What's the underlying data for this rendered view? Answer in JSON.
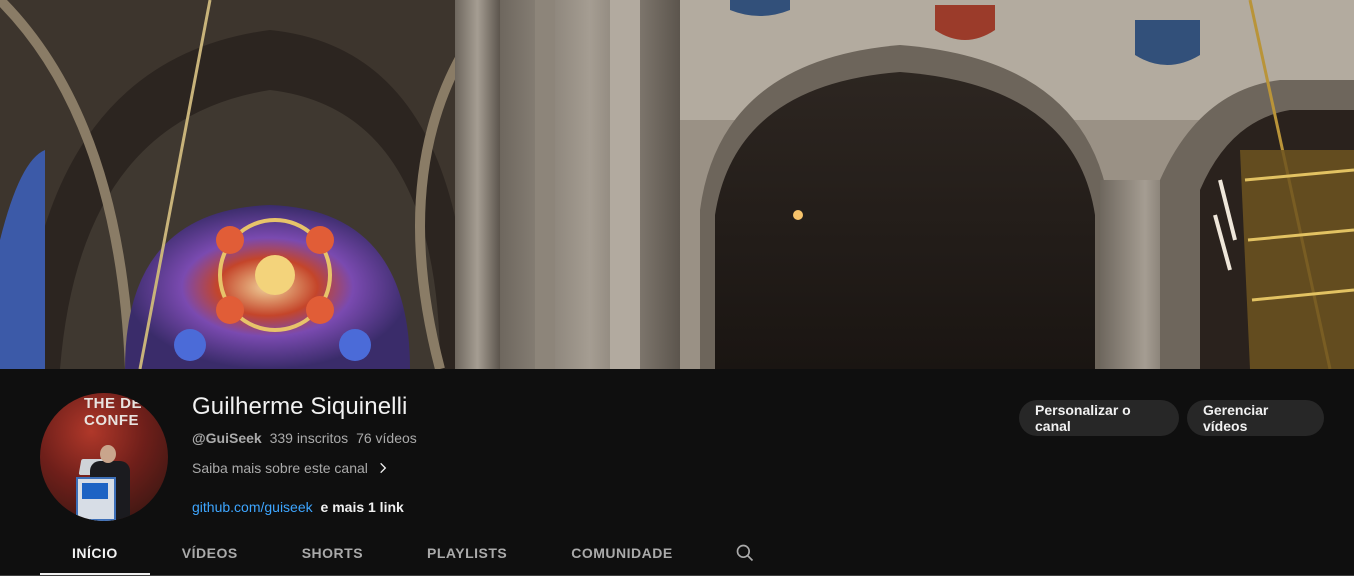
{
  "channel": {
    "name": "Guilherme Siquinelli",
    "handle": "@GuiSeek",
    "subscribers": "339 inscritos",
    "videos": "76 vídeos",
    "about_link": "Saiba mais sobre este canal",
    "link_url": "github.com/guiseek",
    "more_links": "e mais 1 link",
    "avatar_text": "THE DE\nCONFE"
  },
  "actions": {
    "customize_label": "Personalizar o canal",
    "manage_label": "Gerenciar vídeos"
  },
  "tabs": [
    {
      "label": "INÍCIO",
      "active": true
    },
    {
      "label": "VÍDEOS",
      "active": false
    },
    {
      "label": "SHORTS",
      "active": false
    },
    {
      "label": "PLAYLISTS",
      "active": false
    },
    {
      "label": "COMUNIDADE",
      "active": false
    }
  ],
  "icons": {
    "search": "search-icon",
    "chevron": "chevron-right-icon"
  },
  "colors": {
    "background": "#0f0f0f",
    "link": "#3ea6ff",
    "button": "#272727",
    "secondary_text": "#aaaaaa"
  }
}
